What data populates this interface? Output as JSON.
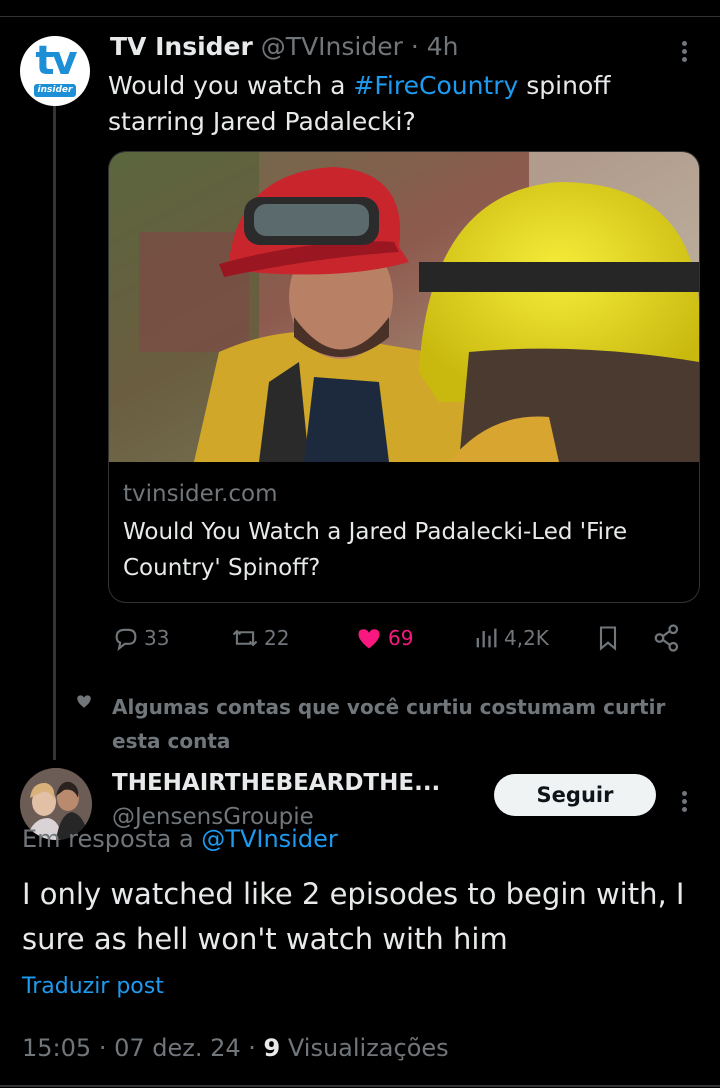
{
  "original_tweet": {
    "author_name": "TV Insider",
    "author_handle": "@TVInsider",
    "separator": " · ",
    "time_ago": "4h",
    "avatar_text": "tv",
    "avatar_subtext": "insider",
    "text_before": "Would you watch a ",
    "hashtag": "#FireCountry",
    "text_after": " spinoff starring Jared Padalecki?",
    "card": {
      "domain": "tvinsider.com",
      "title": "Would You Watch a Jared Padalecki-Led 'Fire Country' Spinoff?"
    },
    "stats": {
      "replies": "33",
      "reposts": "22",
      "likes": "69",
      "views": "4,2K"
    }
  },
  "liked_note": "Algumas contas que você curtiu costumam curtir esta conta",
  "reply": {
    "author_name": "THEHAIRTHEBEARDTHE...",
    "author_handle": "@JensensGroupie",
    "follow_label": "Seguir",
    "reply_prefix": "Em resposta a ",
    "reply_to": "@TVInsider",
    "text": "I only watched like 2 episodes to begin with, I sure as hell won't watch with him",
    "translate_label": "Traduzir post",
    "time": "15:05",
    "date": "07 dez. 24",
    "views_count": "9",
    "views_label": "Visualizações"
  },
  "colors": {
    "background": "#000000",
    "accent": "#1d9bf0",
    "like": "#f91880",
    "muted": "#71767b",
    "text": "#e7e9ea"
  }
}
